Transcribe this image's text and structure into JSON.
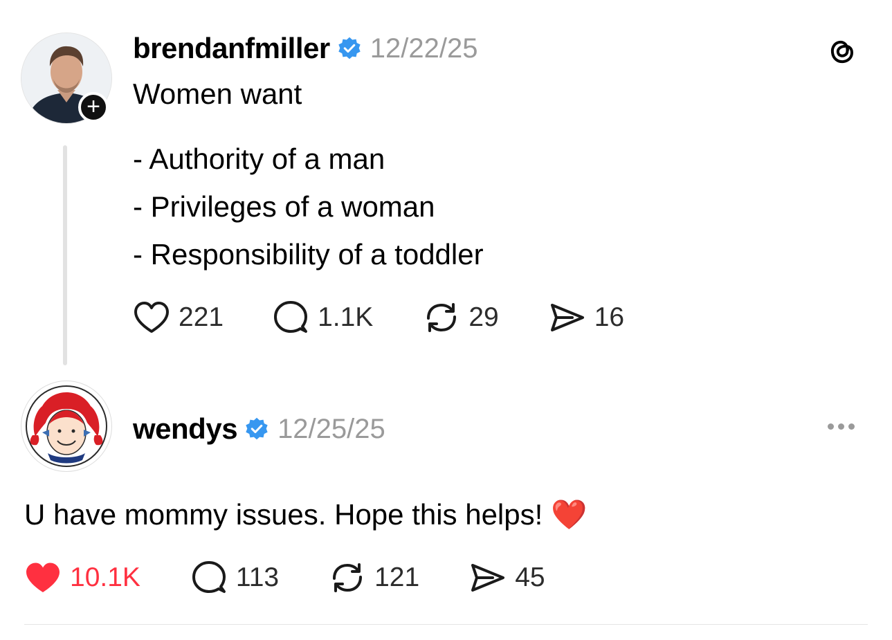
{
  "post": {
    "username": "brendanfmiller",
    "date": "12/22/25",
    "line1": "Women want",
    "items": [
      "- Authority of a man",
      "- Privileges of a woman",
      "- Responsibility of a toddler"
    ],
    "stats": {
      "likes": "221",
      "replies": "1.1K",
      "reposts": "29",
      "shares": "16"
    },
    "app_icon": "threads-logo-icon",
    "follow_icon": "plus-icon"
  },
  "reply": {
    "username": "wendys",
    "date": "12/25/25",
    "text": "U have mommy issues. Hope this helps! ❤️",
    "stats": {
      "likes": "10.1K",
      "replies": "113",
      "reposts": "121",
      "shares": "45"
    },
    "liked": true,
    "more_icon": "more-horizontal-icon"
  },
  "colors": {
    "verified": "#3797F0",
    "like_active": "#FF3040",
    "muted_text": "#9A9A9A"
  }
}
